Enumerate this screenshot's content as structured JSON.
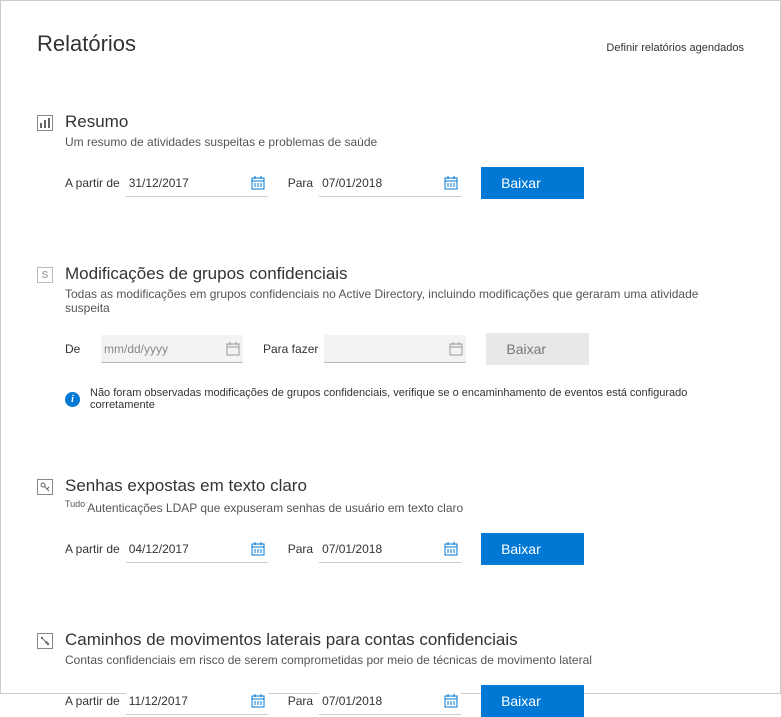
{
  "header": {
    "title": "Relatórios",
    "schedule_link": "Definir relatórios agendados"
  },
  "reports": {
    "summary": {
      "title": "Resumo",
      "desc": "Um resumo de atividades suspeitas e problemas de saúde",
      "from_label": "A partir de",
      "from_value": "31/12/2017",
      "to_label": "Para",
      "to_value": "07/01/2018",
      "button": "Baixar"
    },
    "groups": {
      "title": "Modificações de grupos confidenciais",
      "desc": "Todas as modificações em grupos confidenciais no Active Directory, incluindo modificações que geraram uma atividade suspeita",
      "from_label": "De",
      "from_placeholder": "mm/dd/yyyy",
      "to_label": "Para fazer",
      "button": "Baixar",
      "info": "Não foram observadas modificações de grupos confidenciais, verifique se o encaminhamento de eventos está configurado corretamente"
    },
    "passwords": {
      "title": "Senhas expostas em texto claro",
      "desc_prefix": "Tudo",
      "desc": "Autenticações LDAP que expuseram senhas de usuário em texto claro",
      "from_label": "A partir de",
      "from_value": "04/12/2017",
      "to_label": "Para",
      "to_value": "07/01/2018",
      "button": "Baixar"
    },
    "lateral": {
      "title": "Caminhos de movimentos laterais para contas confidenciais",
      "desc": "Contas confidenciais em risco de serem comprometidas por meio de técnicas de movimento lateral",
      "from_label": "A partir de",
      "from_value": "11/12/2017",
      "to_label": "Para",
      "to_value": "07/01/2018",
      "button": "Baixar"
    }
  }
}
